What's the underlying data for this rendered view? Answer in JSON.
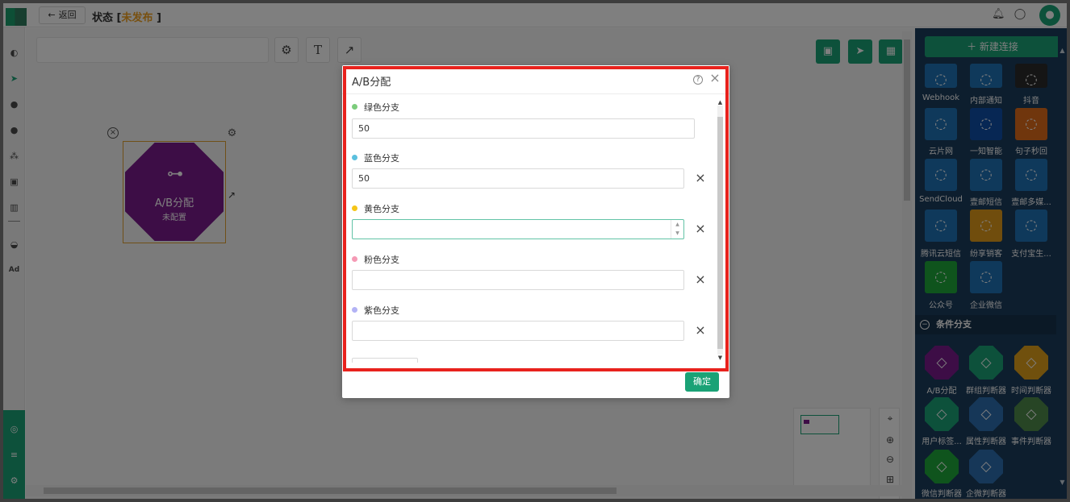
{
  "header": {
    "back_label": "返回",
    "status_prefix": "状态 [",
    "status_value": "未发布",
    "status_suffix": "]"
  },
  "node": {
    "name": "A/B分配",
    "subtitle": "未配置"
  },
  "right_panel": {
    "new_connection_label": "新建连接",
    "channels": [
      {
        "label": "Webhook",
        "color": "#1f73b7"
      },
      {
        "label": "内部通知",
        "color": "#1f73b7"
      },
      {
        "label": "抖音",
        "color": "#2a2a2a"
      },
      {
        "label": "云片网",
        "color": "#1f73b7"
      },
      {
        "label": "一知智能",
        "color": "#0f4fa8"
      },
      {
        "label": "句子秒回",
        "color": "#e06c1a"
      },
      {
        "label": "SendCloud",
        "color": "#1f73b7"
      },
      {
        "label": "壹邮短信",
        "color": "#1f73b7"
      },
      {
        "label": "壹邮多媒...",
        "color": "#1f73b7"
      },
      {
        "label": "腾讯云短信",
        "color": "#1f73b7"
      },
      {
        "label": "纷享销客",
        "color": "#e09a1a"
      },
      {
        "label": "支付宝生...",
        "color": "#1f73b7"
      },
      {
        "label": "公众号",
        "color": "#1fa83a"
      },
      {
        "label": "企业微信",
        "color": "#1f73b7"
      }
    ],
    "condition_section": {
      "title": "条件分支",
      "items": [
        {
          "label": "A/B分配",
          "color": "#7a1b8c"
        },
        {
          "label": "群组判断器",
          "color": "#1aa276"
        },
        {
          "label": "时间判断器",
          "color": "#e0a01a"
        },
        {
          "label": "用户标签...",
          "color": "#1aa276"
        },
        {
          "label": "属性判断器",
          "color": "#2d6fb0"
        },
        {
          "label": "事件判断器",
          "color": "#4f8a4a"
        },
        {
          "label": "微信判断器",
          "color": "#1fa83a"
        },
        {
          "label": "企微判断器",
          "color": "#2d6fb0"
        }
      ]
    }
  },
  "modal": {
    "title": "A/B分配",
    "branches": [
      {
        "label": "绿色分支",
        "color": "#7ccc7c",
        "value": "50",
        "removable": false
      },
      {
        "label": "蓝色分支",
        "color": "#5bc0de",
        "value": "50",
        "removable": true
      },
      {
        "label": "黄色分支",
        "color": "#f5c518",
        "value": "",
        "removable": true
      },
      {
        "label": "粉色分支",
        "color": "#f59ab5",
        "value": "",
        "removable": true
      },
      {
        "label": "紫色分支",
        "color": "#b3b3f5",
        "value": "",
        "removable": true
      }
    ],
    "confirm_label": "确定"
  },
  "colors": {
    "accent": "#1aa276",
    "highlight_border": "#e8221d",
    "panel_bg": "#1b3c5c"
  }
}
